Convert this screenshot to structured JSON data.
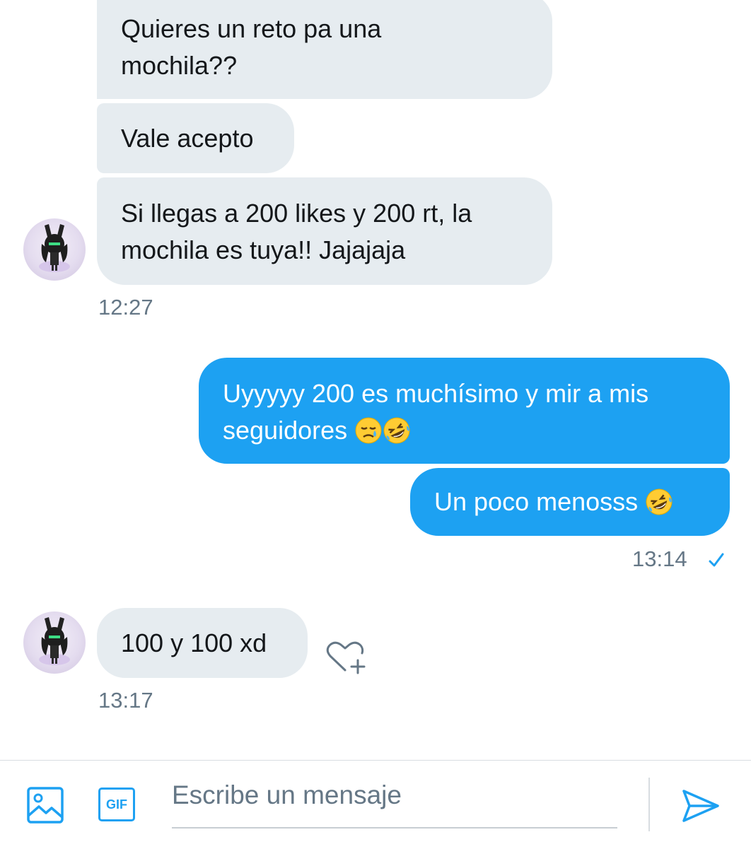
{
  "messages": [
    {
      "id": "m1",
      "direction": "incoming",
      "lines": [
        "Quieres un reto pa una",
        "mochila??"
      ]
    },
    {
      "id": "m2",
      "direction": "incoming",
      "lines": [
        "Vale acepto"
      ]
    },
    {
      "id": "m3",
      "direction": "incoming",
      "lines": [
        "Si llegas a 200 likes y 200 rt, la",
        "mochila es tuya!! Jajajaja"
      ]
    },
    {
      "id": "m4",
      "direction": "outgoing",
      "lines": [
        "Uyyyyy 200 es muchísimo y mir a mis",
        "seguidores"
      ],
      "emojis": [
        "sleepy-face",
        "rolling-laughing-face"
      ]
    },
    {
      "id": "m5",
      "direction": "outgoing",
      "lines": [
        "Un poco menosss"
      ],
      "emojis": [
        "rolling-laughing-face"
      ]
    },
    {
      "id": "m6",
      "direction": "incoming",
      "lines": [
        "100 y 100 xd"
      ]
    }
  ],
  "timestamps": {
    "group1": "12:27",
    "group2": "13:14",
    "group3": "13:17"
  },
  "status": {
    "group2_read": "check-icon"
  },
  "composer": {
    "placeholder": "Escribe un mensaje",
    "gif_label": "GIF"
  },
  "colors": {
    "accent": "#1da1f2",
    "incoming_bubble": "#e6ecf0",
    "timestamp": "#657786"
  }
}
